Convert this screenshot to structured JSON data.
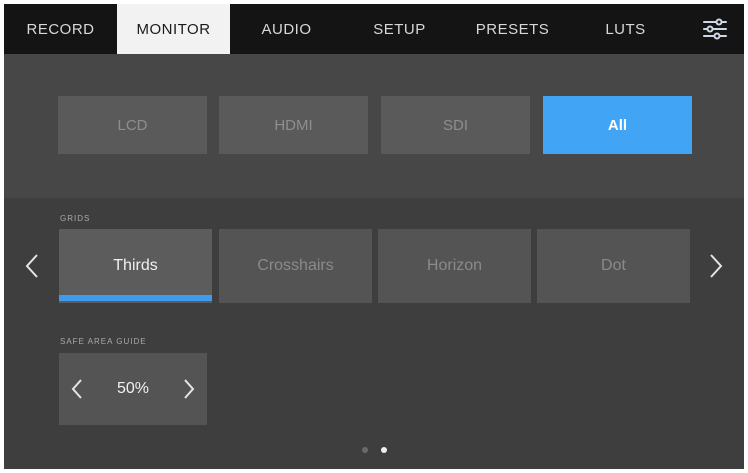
{
  "tabs": [
    {
      "label": "RECORD",
      "active": false
    },
    {
      "label": "MONITOR",
      "active": true
    },
    {
      "label": "AUDIO",
      "active": false
    },
    {
      "label": "SETUP",
      "active": false
    },
    {
      "label": "PRESETS",
      "active": false
    },
    {
      "label": "LUTS",
      "active": false
    }
  ],
  "menu_icon": "sliders-icon",
  "outputs": [
    {
      "label": "LCD",
      "active": false
    },
    {
      "label": "HDMI",
      "active": false
    },
    {
      "label": "SDI",
      "active": false
    },
    {
      "label": "All",
      "active": true
    }
  ],
  "grids": {
    "label": "GRIDS",
    "options": [
      {
        "label": "Thirds",
        "active": true
      },
      {
        "label": "Crosshairs",
        "active": false
      },
      {
        "label": "Horizon",
        "active": false
      },
      {
        "label": "Dot",
        "active": false
      }
    ]
  },
  "safe_area": {
    "label": "SAFE AREA GUIDE",
    "value": "50%"
  },
  "pagination": {
    "total": 2,
    "current": 2
  },
  "colors": {
    "accent": "#42a4f4",
    "tab_active_bg": "#f2f2f2",
    "tab_bar_bg": "#141414",
    "panel_bg": "#3e3e3e"
  }
}
